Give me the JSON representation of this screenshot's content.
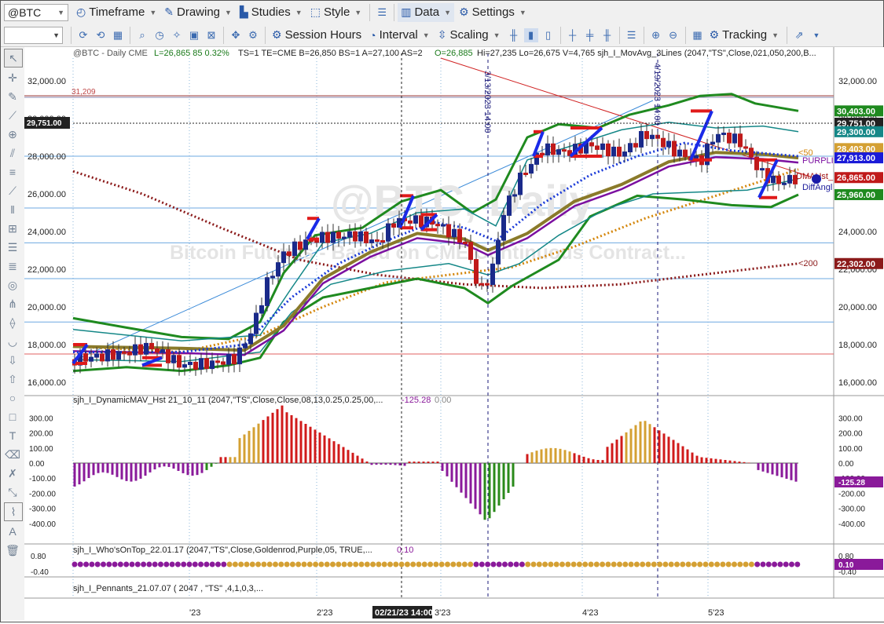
{
  "toolbar1": {
    "symbol": "@BTC",
    "timeframe": "Timeframe",
    "drawing": "Drawing",
    "studies": "Studies",
    "style": "Style",
    "data": "Data",
    "settings": "Settings"
  },
  "toolbar2": {
    "session_hours": "Session Hours",
    "interval": "Interval",
    "scaling": "Scaling",
    "tracking": "Tracking"
  },
  "chart": {
    "header_symbol": "@BTC - Daily  CME",
    "header_stats": "L=26,865  85  0.32%",
    "header_rest": "TS=1  TE=CME  B=26,850  BS=1  A=27,100  AS=2",
    "header_open": "O=26,885",
    "header_tail": "Hi=27,235  Lo=26,675  V=4,765  sjh_I_MovAvg_3Lines (2047,\"TS\",Close,021,050,200,B...",
    "watermark": "@BTC, Daily",
    "watermark_sub": "Bitcoin Futures - Based on CME Continuous Contract...",
    "date_line_1": "3/13/2023 14:00",
    "date_line_2": "4/19/2023 14:00",
    "crosshair_price": "29,751.00",
    "level_31209": "31,209",
    "price_ticks": [
      "32,000.00",
      "30,000.00",
      "28,000.00",
      "26,000.00",
      "24,000.00",
      "22,000.00",
      "20,000.00",
      "18,000.00",
      "16,000.00"
    ],
    "right_labels": {
      "r30403": "30,403.00",
      "r29751": "29,751.00",
      "r29300": "29,300.00",
      "r28403": "28,403.00",
      "r27913": "27,913.00",
      "r26865": "26,865.00",
      "r25960": "25,960.00",
      "r22302": "22,302.00"
    },
    "ma_labels": {
      "m50": "<50",
      "purple": "PURPLI",
      "dmahst": "DMAHst_",
      "diffangl": "DiffAngl",
      "m200": "<200"
    }
  },
  "panel1": {
    "title": "sjh_I_DynamicMAV_Hst 21_10_11 (2047,\"TS\",Close,Close,08,13,0.25,0.25,00,...",
    "value": "-125.28",
    "value2": "0.00",
    "ticks": [
      "300.00",
      "200.00",
      "100.00",
      "0.00",
      "-100.00",
      "-200.00",
      "-300.00",
      "-400.00"
    ],
    "last_label": "-125.28"
  },
  "panel2": {
    "title": "sjh_I_Who'sOnTop_22.01.17 (2047,\"TS\",Close,Goldenrod,Purple,05, TRUE,...",
    "value": "0.10",
    "ticks": [
      "0.80",
      "-0.40"
    ],
    "last_label": "0.10"
  },
  "panel3": {
    "title": "sjh_I_Pennants_21.07.07 ( 2047 , \"TS\" ,4,1,0,3,..."
  },
  "xaxis": {
    "labels": [
      "'23",
      "2'23",
      "3'23",
      "4'23",
      "5'23"
    ],
    "cursor_label": "02/21/23 14:00"
  },
  "colors": {
    "ma21": "#7b0fa0",
    "ma50": "#d4860b",
    "ma200": "#8b1a1a",
    "envelope": "#1f8a1f",
    "inner_band": "#148787",
    "hist_up": "#d4a033",
    "hist_red": "#d01a1a",
    "hist_purple": "#8a1a9a",
    "hist_green": "#2a8a1a"
  }
}
